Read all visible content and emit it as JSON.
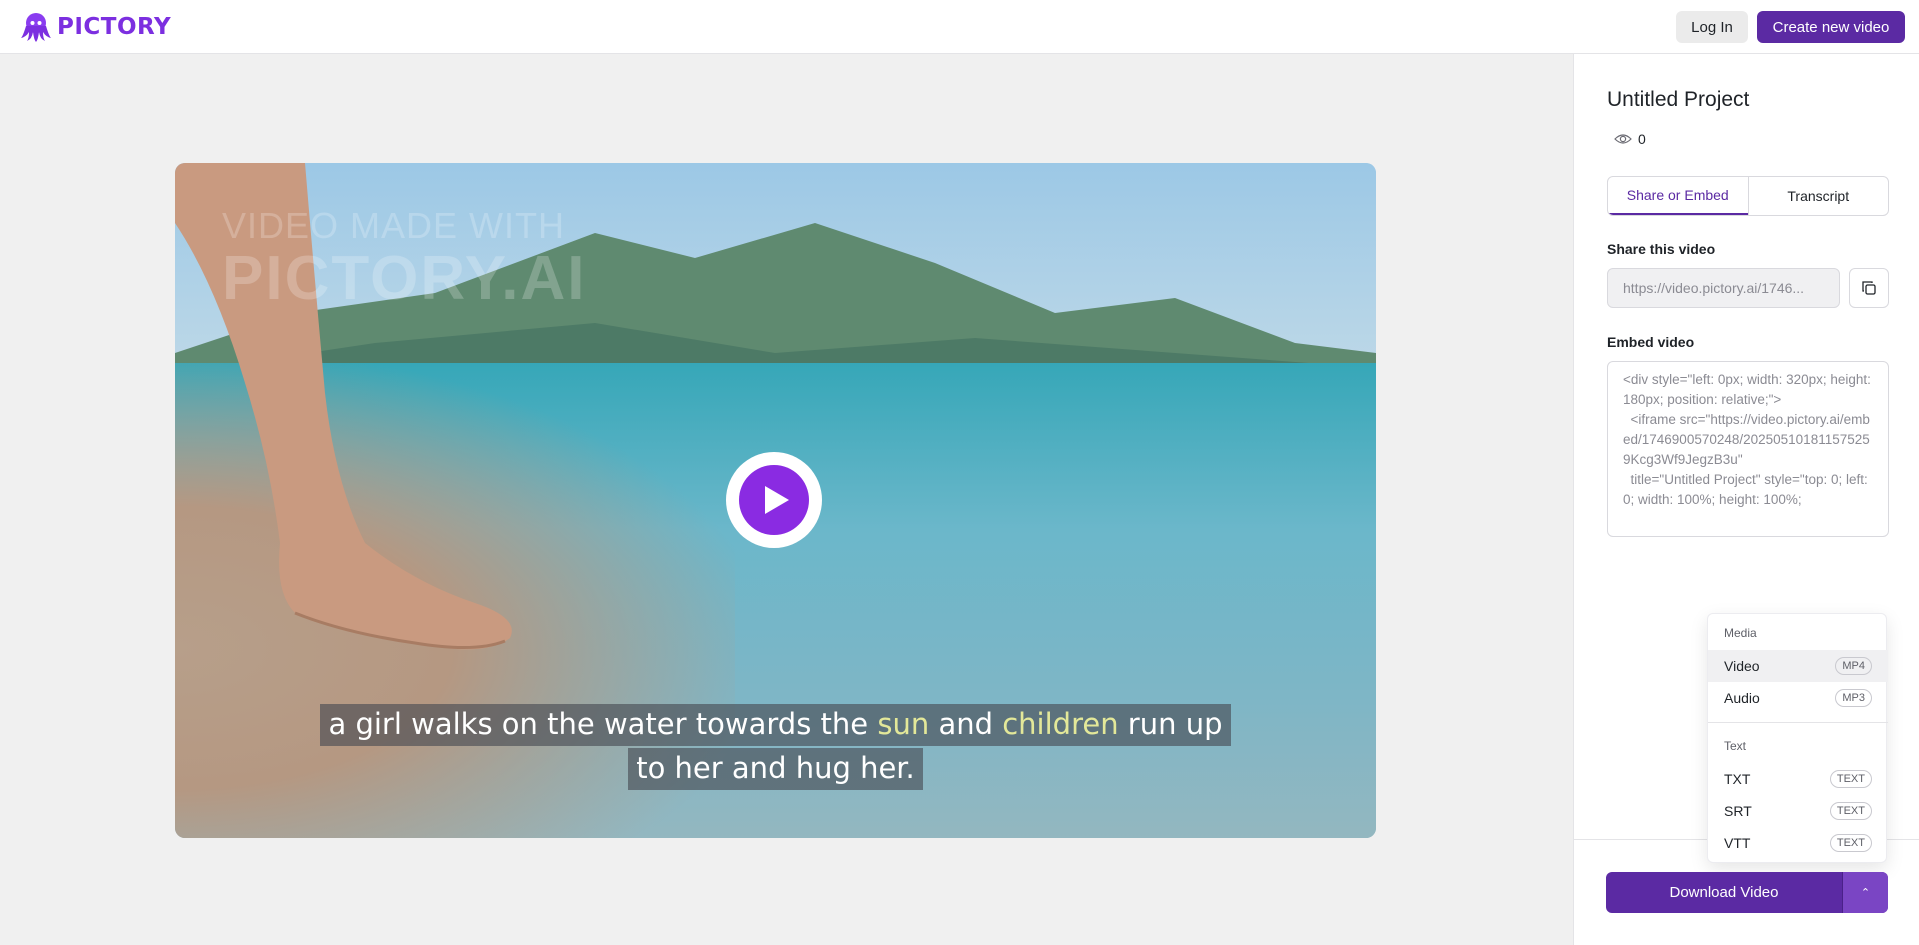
{
  "header": {
    "brand": "PICTORY",
    "login_label": "Log In",
    "create_label": "Create new video"
  },
  "video": {
    "watermark_line1": "VIDEO MADE WITH",
    "watermark_line2": "PICTORY.AI",
    "caption_line1": {
      "a": "a girl walks on the water towards the ",
      "b": "sun",
      "c": " and ",
      "d": "children",
      "e": " run up"
    },
    "caption_line2": "to her and hug her.",
    "caption_highlight_color": "#e3e899"
  },
  "panel": {
    "project_title": "Untitled Project",
    "view_count": "0",
    "tabs": [
      {
        "label": "Share or Embed",
        "active": true
      },
      {
        "label": "Transcript",
        "active": false
      }
    ],
    "share_label": "Share this video",
    "share_url": "https://video.pictory.ai/1746...",
    "embed_label": "Embed video",
    "embed_code": "<div style=\"left: 0px; width: 320px; height: 180px; position: relative;\">\n  <iframe src=\"https://video.pictory.ai/embed/1746900570248/20250510181157525 9Kcg3Wf9JegzB3u\"\n  title=\"Untitled Project\" style=\"top: 0; left: 0; width: 100%; height: 100%;"
  },
  "download_menu": {
    "media_heading": "Media",
    "media_items": [
      {
        "label": "Video",
        "badge": "MP4"
      },
      {
        "label": "Audio",
        "badge": "MP3"
      }
    ],
    "text_heading": "Text",
    "text_items": [
      {
        "label": "TXT",
        "badge": "TEXT"
      },
      {
        "label": "SRT",
        "badge": "TEXT"
      },
      {
        "label": "VTT",
        "badge": "TEXT"
      }
    ]
  },
  "download": {
    "label": "Download Video",
    "caret": "⌃"
  },
  "colors": {
    "brand_purple": "#5b2aa3",
    "logo_purple": "#7c2fe0",
    "play_purple": "#8a2be2"
  },
  "icons": {
    "logo": "octopus-logo-icon",
    "play": "play-icon",
    "eye": "eye-icon",
    "copy": "copy-icon",
    "caret": "chevron-up-icon"
  }
}
